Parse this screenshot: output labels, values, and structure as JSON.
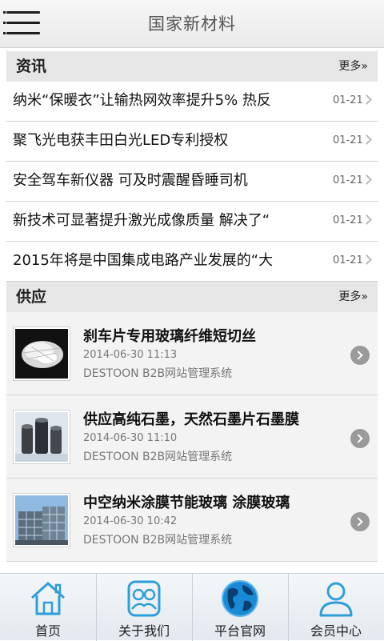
{
  "header": {
    "title": "国家新材料"
  },
  "news": {
    "title": "资讯",
    "more": "更多»",
    "items": [
      {
        "title": "纳米“保暖衣”让输热网效率提升5% 热反",
        "date": "01-21"
      },
      {
        "title": "聚飞光电获丰田白光LED专利授权",
        "date": "01-21"
      },
      {
        "title": "安全驾车新仪器 可及时震醒昏睡司机",
        "date": "01-21"
      },
      {
        "title": "新技术可显著提升激光成像质量 解决了“",
        "date": "01-21"
      },
      {
        "title": "2015年将是中国集成电路产业发展的“大",
        "date": "01-21"
      }
    ]
  },
  "supply": {
    "title": "供应",
    "more": "更多»",
    "items": [
      {
        "title": "刹车片专用玻璃纤维短切丝",
        "date": "2014-06-30 11:13",
        "company": "DESTOON B2B网站管理系统",
        "thumb": "glass-fiber-image"
      },
      {
        "title": "供应高纯石墨，天然石墨片石墨膜",
        "date": "2014-06-30 11:10",
        "company": "DESTOON B2B网站管理系统",
        "thumb": "graphite-tubes-image"
      },
      {
        "title": "中空纳米涂膜节能玻璃 涂膜玻璃",
        "date": "2014-06-30 10:42",
        "company": "DESTOON B2B网站管理系统",
        "thumb": "glass-building-image"
      }
    ]
  },
  "tabs": [
    {
      "label": "首页",
      "icon": "home-icon"
    },
    {
      "label": "关于我们",
      "icon": "about-icon"
    },
    {
      "label": "平台官网",
      "icon": "globe-icon"
    },
    {
      "label": "会员中心",
      "icon": "user-icon"
    }
  ],
  "colors": {
    "tab_icon": "#2f9fd8",
    "globe_icon": "#1a8ad6",
    "section_bg": "#e6e6e6"
  }
}
